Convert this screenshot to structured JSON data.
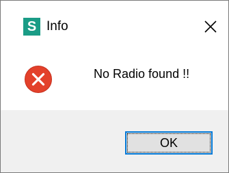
{
  "window": {
    "title": "Info",
    "app_icon_letter": "S",
    "app_icon": "app-logo-icon",
    "close_icon": "close-icon"
  },
  "message": {
    "text": "No Radio found !!",
    "icon": "error-icon"
  },
  "buttons": {
    "ok_label": "OK"
  },
  "colors": {
    "brand": "#1a9c86",
    "error": "#e3412b",
    "focus_border": "#0078d7",
    "footer_bg": "#f0f0f0"
  }
}
